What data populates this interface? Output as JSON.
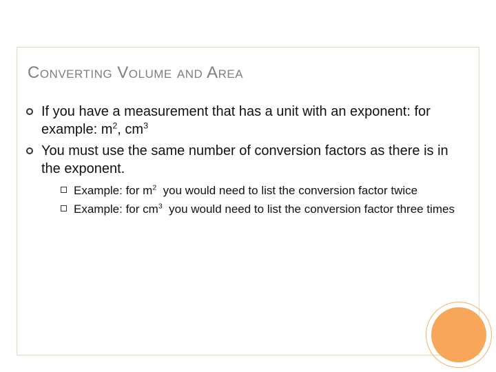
{
  "title": "Converting Volume and Area",
  "bullets": [
    {
      "text_html": "If you have a measurement that has a unit with an exponent: for example: m<sup>2</sup>, cm<sup>3</sup>"
    },
    {
      "text_html": "You must use the same number of conversion factors as there is in the exponent."
    }
  ],
  "sub_bullets": [
    {
      "text_html": "Example: for m<sup>2</sup>&nbsp; you would need to list the conversion factor twice"
    },
    {
      "text_html": "Example: for cm<sup>3</sup>&nbsp; you would need to list the conversion factor three times"
    }
  ]
}
